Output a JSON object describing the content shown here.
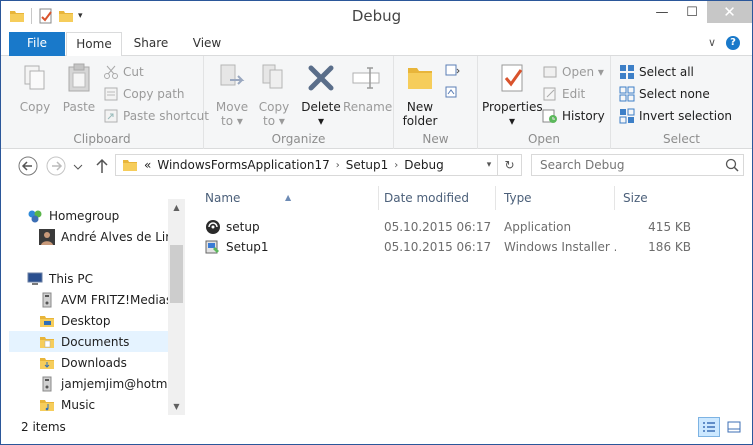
{
  "window": {
    "title": "Debug"
  },
  "title_bar": {
    "minimize": "—",
    "maximize": "☐",
    "close": "✕",
    "qat_dropdown": "▾"
  },
  "tabs": [
    {
      "label": "File"
    },
    {
      "label": "Home"
    },
    {
      "label": "Share"
    },
    {
      "label": "View"
    }
  ],
  "tab_icons": {
    "collapse": "∨",
    "help": "?"
  },
  "ribbon": {
    "clipboard": {
      "label": "Clipboard",
      "copy": "Copy",
      "paste": "Paste",
      "cut": "Cut",
      "copy_path": "Copy path",
      "paste_shortcut": "Paste shortcut"
    },
    "organize": {
      "label": "Organize",
      "move_to": [
        "Move",
        "to ▾"
      ],
      "copy_to": [
        "Copy",
        "to ▾"
      ],
      "delete": [
        "Delete",
        "▾"
      ],
      "rename": "Rename"
    },
    "new": {
      "label": "New",
      "new_folder": [
        "New",
        "folder"
      ]
    },
    "open": {
      "label": "Open",
      "properties": [
        "Properties",
        "▾"
      ],
      "open": "Open ▾",
      "edit": "Edit",
      "history": "History"
    },
    "select": {
      "label": "Select",
      "select_all": "Select all",
      "select_none": "Select none",
      "invert_selection": "Invert selection"
    }
  },
  "address_bar": {
    "prefix": "«",
    "crumbs": [
      "WindowsFormsApplication17",
      "Setup1",
      "Debug"
    ],
    "separator": "›",
    "dropdown": "▾",
    "refresh": "↻"
  },
  "search": {
    "placeholder": "Search Debug"
  },
  "nav_pane": {
    "items": [
      {
        "label": "Homegroup",
        "icon": "homegroup-icon"
      },
      {
        "label": "André Alves de Lima",
        "icon": "user-avatar-icon"
      },
      {
        "label": "This PC",
        "icon": "computer-icon"
      },
      {
        "label": "AVM FRITZ!Mediaser",
        "icon": "media-server-icon"
      },
      {
        "label": "Desktop",
        "icon": "folder-icon"
      },
      {
        "label": "Documents",
        "icon": "folder-icon"
      },
      {
        "label": "Downloads",
        "icon": "folder-icon"
      },
      {
        "label": "jamjemjim@hotmail",
        "icon": "media-server-icon"
      },
      {
        "label": "Music",
        "icon": "folder-icon"
      }
    ],
    "scroll_up": "▲",
    "scroll_down": "▼"
  },
  "file_list": {
    "columns": [
      "Name",
      "Date modified",
      "Type",
      "Size"
    ],
    "sort_indicator": "▲",
    "rows": [
      {
        "name": "setup",
        "date": "05.10.2015 06:17",
        "type": "Application",
        "size": "415 KB",
        "icon": "setup-exe-icon"
      },
      {
        "name": "Setup1",
        "date": "05.10.2015 06:17",
        "type": "Windows Installer ...",
        "size": "186 KB",
        "icon": "msi-installer-icon"
      }
    ]
  },
  "status_bar": {
    "count": "2 items"
  },
  "colors": {
    "accent": "#1979ca",
    "selection": "#e5f3ff",
    "header_text": "#4c607a"
  }
}
